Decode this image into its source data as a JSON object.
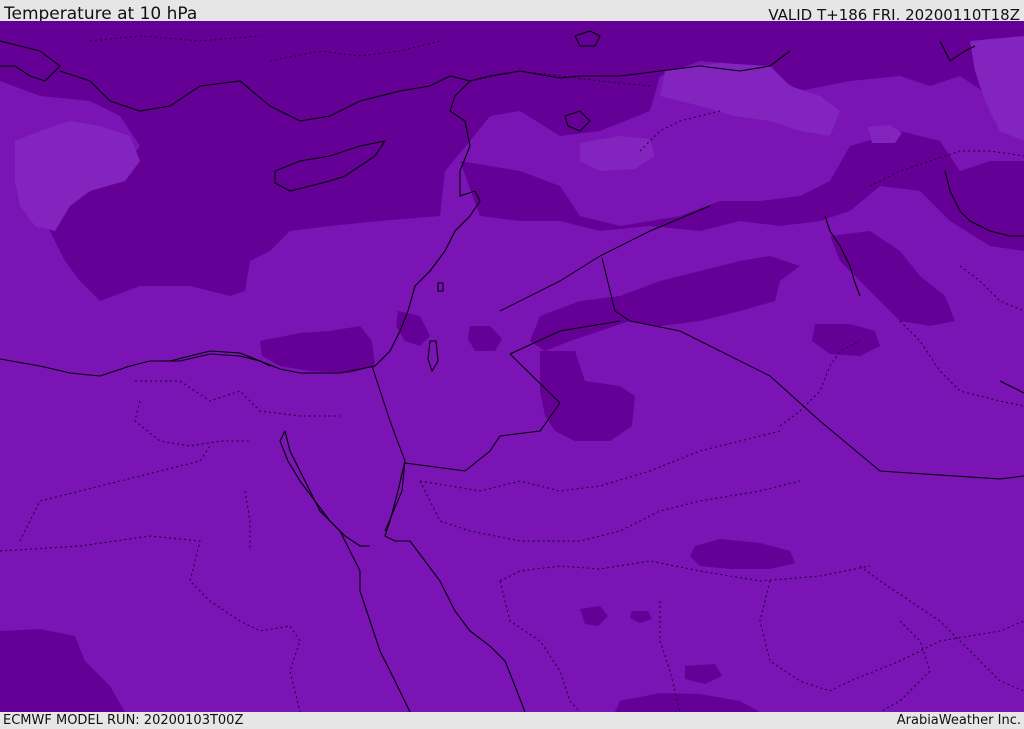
{
  "header": {
    "title": "Temperature at 10 hPa",
    "valid": "VALID T+186 FRI. 20200110T18Z"
  },
  "footer": {
    "model_run": "ECMWF MODEL RUN: 20200103T00Z",
    "credit": "ArabiaWeather Inc."
  },
  "map": {
    "colors": {
      "field_light": "#7a14b4",
      "field_dark": "#640096",
      "field_lighter": "#8424bf",
      "coastline": "#000000",
      "border": "#000000"
    }
  }
}
